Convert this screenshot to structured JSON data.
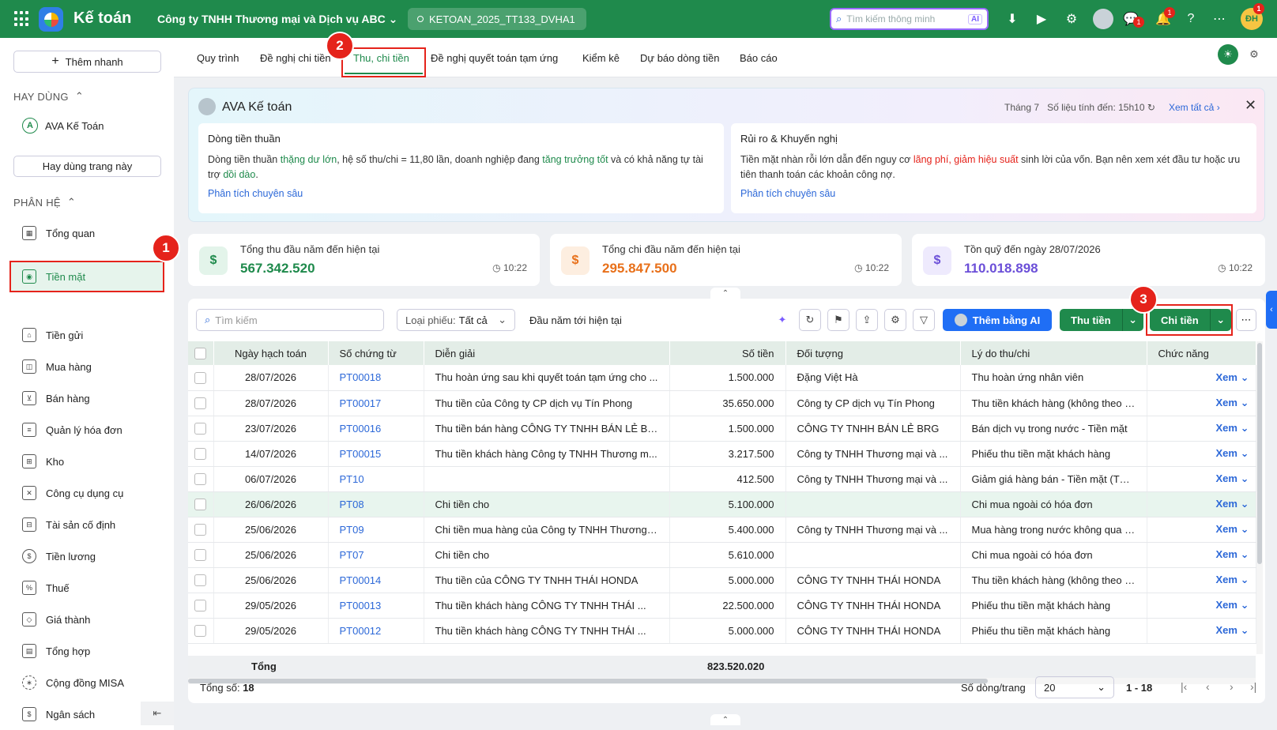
{
  "topbar": {
    "app_name": "Kế toán",
    "company": "Công ty TNHH Thương mại và Dịch vụ ABC",
    "database": "KETOAN_2025_TT133_DVHA1",
    "search_placeholder": "Tìm kiếm thông minh",
    "search_ai": "AI",
    "chat_badge": "1",
    "notif_badge": "1",
    "avatar_initials": "ĐH",
    "avatar_badge": "1"
  },
  "sidebar": {
    "quick_add": "Thêm nhanh",
    "frequent_label": "HAY DÙNG",
    "ava_item": "AVA Kế Toán",
    "pin_page": "Hay dùng trang này",
    "modules_label": "PHÂN HỆ",
    "items": [
      {
        "label": "Tổng quan",
        "icon": "dashboard-icon"
      },
      {
        "label": "Tiền mặt",
        "icon": "cash-icon"
      },
      {
        "label": "Tiền gửi",
        "icon": "bank-icon"
      },
      {
        "label": "Mua hàng",
        "icon": "bag-icon"
      },
      {
        "label": "Bán hàng",
        "icon": "cart-icon"
      },
      {
        "label": "Quản lý hóa đơn",
        "icon": "invoice-icon"
      },
      {
        "label": "Kho",
        "icon": "warehouse-icon"
      },
      {
        "label": "Công cụ dụng cụ",
        "icon": "tools-icon"
      },
      {
        "label": "Tài sản cố định",
        "icon": "car-icon"
      },
      {
        "label": "Tiền lương",
        "icon": "salary-icon"
      },
      {
        "label": "Thuế",
        "icon": "tax-icon"
      },
      {
        "label": "Giá thành",
        "icon": "price-tag-icon"
      },
      {
        "label": "Tổng hợp",
        "icon": "ledger-icon"
      },
      {
        "label": "Cộng đồng MISA",
        "icon": "community-icon"
      },
      {
        "label": "Ngân sách",
        "icon": "budget-icon"
      }
    ]
  },
  "steps": [
    "1",
    "2",
    "3"
  ],
  "tabs": [
    "Quy trình",
    "Đề nghị chi tiền",
    "Thu, chi tiền",
    "Đề nghị quyết toán tạm ứng",
    "Kiểm kê",
    "Dự báo dòng tiền",
    "Báo cáo"
  ],
  "ava_panel": {
    "title": "AVA Kế toán",
    "month": "Tháng 7",
    "updated": "Số liệu tính đến: 15h10",
    "view_all": "Xem tất cả",
    "cards": [
      {
        "title": "Dòng tiền thuần",
        "p1": "Dòng tiền thuần ",
        "h1": "thặng dư lớn",
        "p2": ", hệ số thu/chi = 11,80 lần, doanh nghiệp đang ",
        "h2": "tăng trưởng tốt",
        "p3": " và có khả năng tự tài trợ ",
        "h3": "dồi dào",
        "p4": ".",
        "link": "Phân tích chuyên sâu"
      },
      {
        "title": "Rủi ro & Khuyến nghị",
        "p1": "Tiền mặt nhàn rỗi lớn dẫn đến nguy cơ ",
        "h1": "lãng phí, giảm hiệu suất",
        "p2": " sinh lời của vốn. Bạn nên xem xét đầu tư hoặc ưu tiên thanh toán các khoản công nợ.",
        "link": "Phân tích chuyên sâu"
      }
    ]
  },
  "stats": [
    {
      "label": "Tổng thu đầu năm đến hiện tại",
      "value": "567.342.520",
      "time": "10:22",
      "color": "#1f8a4c"
    },
    {
      "label": "Tổng chi đầu năm đến hiện tại",
      "value": "295.847.500",
      "time": "10:22",
      "color": "#e8701a"
    },
    {
      "label": "Tồn quỹ đến ngày 28/07/2026",
      "value": "110.018.898",
      "time": "10:22",
      "color": "#6b4fd8"
    }
  ],
  "toolbar": {
    "search_placeholder": "Tìm kiếm",
    "type_label": "Loại phiếu: ",
    "type_value": "Tất cả",
    "period": "Đầu năm tới hiện tại",
    "ai_add": "Thêm bằng AI",
    "receive": "Thu tiền",
    "pay": "Chi tiền"
  },
  "table": {
    "headers": [
      "Ngày hạch toán",
      "Số chứng từ",
      "Diễn giải",
      "Số tiền",
      "Đối tượng",
      "Lý do thu/chi",
      "Chức năng"
    ],
    "view_label": "Xem",
    "rows": [
      {
        "date": "28/07/2026",
        "no": "PT00018",
        "desc": "Thu hoàn ứng sau khi quyết toán tạm ứng cho ...",
        "amount": "1.500.000",
        "obj": "Đặng Việt Hà",
        "reason": "Thu hoàn ứng nhân viên"
      },
      {
        "date": "28/07/2026",
        "no": "PT00017",
        "desc": "Thu tiền của Công ty CP dịch vụ Tín Phong",
        "amount": "35.650.000",
        "obj": "Công ty CP dịch vụ Tín Phong",
        "reason": "Thu tiền khách hàng (không theo hóa"
      },
      {
        "date": "23/07/2026",
        "no": "PT00016",
        "desc": "Thu tiền bán hàng CÔNG TY TNHH BÁN LẺ BRG",
        "amount": "1.500.000",
        "obj": "CÔNG TY TNHH BÁN LẺ BRG",
        "reason": "Bán dịch vụ trong nước - Tiền mặt"
      },
      {
        "date": "14/07/2026",
        "no": "PT00015",
        "desc": "Thu tiền khách hàng Công ty TNHH Thương m...",
        "amount": "3.217.500",
        "obj": "Công ty TNHH Thương mại và ...",
        "reason": "Phiếu thu tiền mặt khách hàng"
      },
      {
        "date": "06/07/2026",
        "no": "PT10",
        "desc": "",
        "amount": "412.500",
        "obj": "Công ty TNHH Thương mại và ...",
        "reason": "Giảm giá hàng bán - Tiền mặt (Từ bán"
      },
      {
        "date": "26/06/2026",
        "no": "PT08",
        "desc": "Chi tiền cho",
        "amount": "5.100.000",
        "obj": "",
        "reason": "Chi mua ngoài có hóa đơn"
      },
      {
        "date": "25/06/2026",
        "no": "PT09",
        "desc": "Chi tiền mua hàng của Công ty TNHH Thương ...",
        "amount": "5.400.000",
        "obj": "Công ty TNHH Thương mại và ...",
        "reason": "Mua hàng trong nước không qua kho"
      },
      {
        "date": "25/06/2026",
        "no": "PT07",
        "desc": "Chi tiền cho",
        "amount": "5.610.000",
        "obj": "",
        "reason": "Chi mua ngoài có hóa đơn"
      },
      {
        "date": "25/06/2026",
        "no": "PT00014",
        "desc": "Thu tiền của CÔNG TY TNHH THÁI HONDA",
        "amount": "5.000.000",
        "obj": "CÔNG TY TNHH THÁI HONDA",
        "reason": "Thu tiền khách hàng (không theo hóa"
      },
      {
        "date": "29/05/2026",
        "no": "PT00013",
        "desc": "Thu tiền khách hàng CÔNG TY TNHH THÁI ...",
        "amount": "22.500.000",
        "obj": "CÔNG TY TNHH THÁI HONDA",
        "reason": "Phiếu thu tiền mặt khách hàng"
      },
      {
        "date": "29/05/2026",
        "no": "PT00012",
        "desc": "Thu tiền khách hàng CÔNG TY TNHH THÁI ...",
        "amount": "5.000.000",
        "obj": "CÔNG TY TNHH THÁI HONDA",
        "reason": "Phiếu thu tiền mặt khách hàng"
      }
    ],
    "total_label": "Tổng",
    "total_value": "823.520.020"
  },
  "footer": {
    "count_label": "Tổng số: ",
    "count": "18",
    "rows_per_page_label": "Số dòng/trang",
    "rows_per_page": "20",
    "range": "1 - 18"
  }
}
